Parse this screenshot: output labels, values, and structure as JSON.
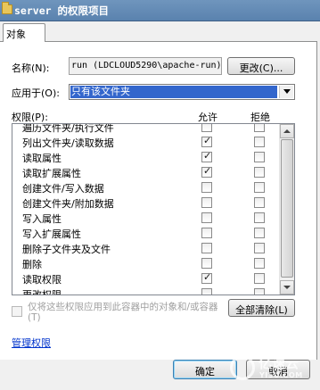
{
  "window": {
    "title": "server 的权限项目"
  },
  "tabs": [
    {
      "label": "对象",
      "selected": true
    }
  ],
  "name_row": {
    "label": "名称(N):",
    "value": "run (LDCLOUD5290\\apache-run)",
    "change_button": "更改(C)..."
  },
  "apply_row": {
    "label": "应用于(O):",
    "selected": "只有该文件夹"
  },
  "permissions": {
    "label": "权限(P):",
    "allow_header": "允许",
    "deny_header": "拒绝",
    "items": [
      {
        "name": "遍历文件夹/执行文件",
        "allow": false,
        "deny": false
      },
      {
        "name": "列出文件夹/读取数据",
        "allow": true,
        "deny": false
      },
      {
        "name": "读取属性",
        "allow": true,
        "deny": false
      },
      {
        "name": "读取扩展属性",
        "allow": true,
        "deny": false
      },
      {
        "name": "创建文件/写入数据",
        "allow": false,
        "deny": false
      },
      {
        "name": "创建文件夹/附加数据",
        "allow": false,
        "deny": false
      },
      {
        "name": "写入属性",
        "allow": false,
        "deny": false
      },
      {
        "name": "写入扩展属性",
        "allow": false,
        "deny": false
      },
      {
        "name": "删除子文件夹及文件",
        "allow": false,
        "deny": false
      },
      {
        "name": "删除",
        "allow": false,
        "deny": false
      },
      {
        "name": "读取权限",
        "allow": true,
        "deny": false
      },
      {
        "name": "更改权限",
        "allow": false,
        "deny": false
      }
    ]
  },
  "inherit_option": {
    "text": "仅将这些权限应用到此容器中的对象和/或容器(T)",
    "checked": false,
    "enabled": false
  },
  "clear_all_button": "全部清除(L)",
  "manage_link": "管理权限",
  "ok_button": "确定",
  "cancel_button": "取消",
  "watermark": {
    "text": "亿速云",
    "sub": "YISU.COM"
  },
  "colors": {
    "titlebar": "#6f95bd",
    "selection": "#3366cc",
    "link": "#0033cc"
  },
  "icons": [
    "folder-icon",
    "chevron-down-icon",
    "arrow-up-icon",
    "arrow-down-icon",
    "check-icon"
  ]
}
